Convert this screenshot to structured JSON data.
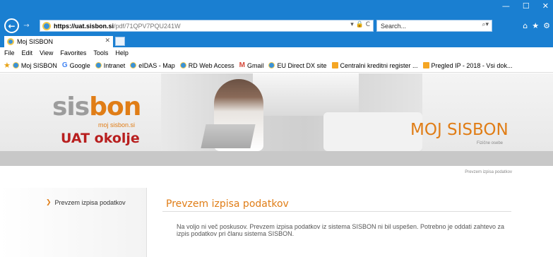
{
  "browser": {
    "url_host": "https://uat.sisbon.si",
    "url_path": "/pdf/71QPV7PQU241W",
    "address_tools": "▾ 🔒 C",
    "search_placeholder": "Search...",
    "search_icon": "⌕▾",
    "window_controls": [
      "—",
      "☐",
      "✕"
    ],
    "right_icons": [
      "⌂",
      "★",
      "⚙"
    ],
    "tab_title": "Moj SISBON",
    "tab_close": "✕",
    "back_glyph": "←",
    "forward_glyph": "→"
  },
  "menu": [
    "File",
    "Edit",
    "View",
    "Favorites",
    "Tools",
    "Help"
  ],
  "favorites": [
    {
      "label": "Moj SISBON",
      "icon": "ie-icon"
    },
    {
      "label": "Google",
      "icon": "google-icon"
    },
    {
      "label": "Intranet",
      "icon": "ie-icon"
    },
    {
      "label": "eIDAS - Map",
      "icon": "ie-icon"
    },
    {
      "label": "RD Web Access",
      "icon": "ie-icon"
    },
    {
      "label": "Gmail",
      "icon": "gmail-icon"
    },
    {
      "label": "EU Direct DX site",
      "icon": "ie-icon"
    },
    {
      "label": "Centralni kreditni register ...",
      "icon": "orange-icon"
    },
    {
      "label": "Pregled IP - 2018 - Vsi dok...",
      "icon": "orange-icon"
    }
  ],
  "header": {
    "logo_sis": "sis",
    "logo_bon": "bon",
    "logo_sub": "moj sisbon.si",
    "environment": "UAT okolje",
    "title": "MOJ SISBON",
    "subtitle": "Fizične osebe"
  },
  "breadcrumb": "Prevzem izpisa podatkov",
  "sidebar": {
    "items": [
      {
        "label": "Prevzem izpisa podatkov"
      }
    ]
  },
  "content": {
    "title": "Prevzem izpisa podatkov",
    "message": "Na voljo ni več poskusov. Prevzem izpisa podatkov iz sistema SISBON ni bil uspešen. Potrebno je oddati zahtevo za izpis podatkov pri članu sistema SISBON."
  },
  "colors": {
    "chrome_blue": "#1a7fd1",
    "brand_orange": "#e07d16",
    "env_red": "#b81f1f",
    "logo_grey": "#9c9c9c"
  }
}
